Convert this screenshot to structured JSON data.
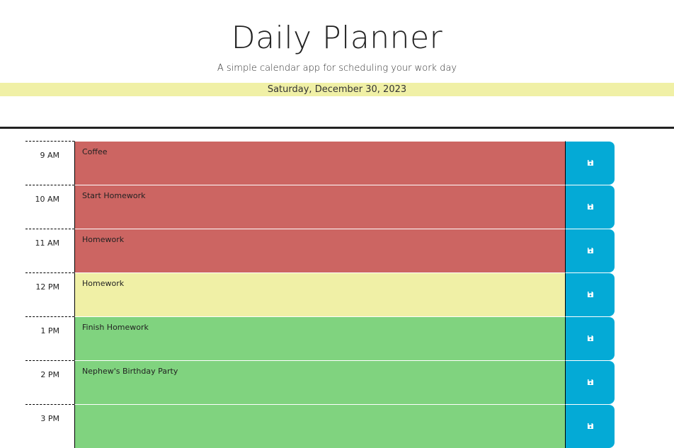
{
  "header": {
    "title": "Daily Planner",
    "subtitle": "A simple calendar app for scheduling your work day",
    "date": "Saturday, December 30, 2023"
  },
  "colors": {
    "past": "#cc6562",
    "present": "#f0f0a6",
    "future": "#80d37f",
    "save": "#04aad6"
  },
  "rows": [
    {
      "hour": "9 AM",
      "text": "Coffee",
      "state": "past"
    },
    {
      "hour": "10 AM",
      "text": "Start Homework",
      "state": "past"
    },
    {
      "hour": "11 AM",
      "text": "Homework",
      "state": "past"
    },
    {
      "hour": "12 PM",
      "text": "Homework",
      "state": "present"
    },
    {
      "hour": "1 PM",
      "text": "Finish Homework",
      "state": "future"
    },
    {
      "hour": "2 PM",
      "text": "Nephew's Birthday Party",
      "state": "future"
    },
    {
      "hour": "3 PM",
      "text": "",
      "state": "future"
    }
  ],
  "save_icon": "floppy-disk-icon"
}
